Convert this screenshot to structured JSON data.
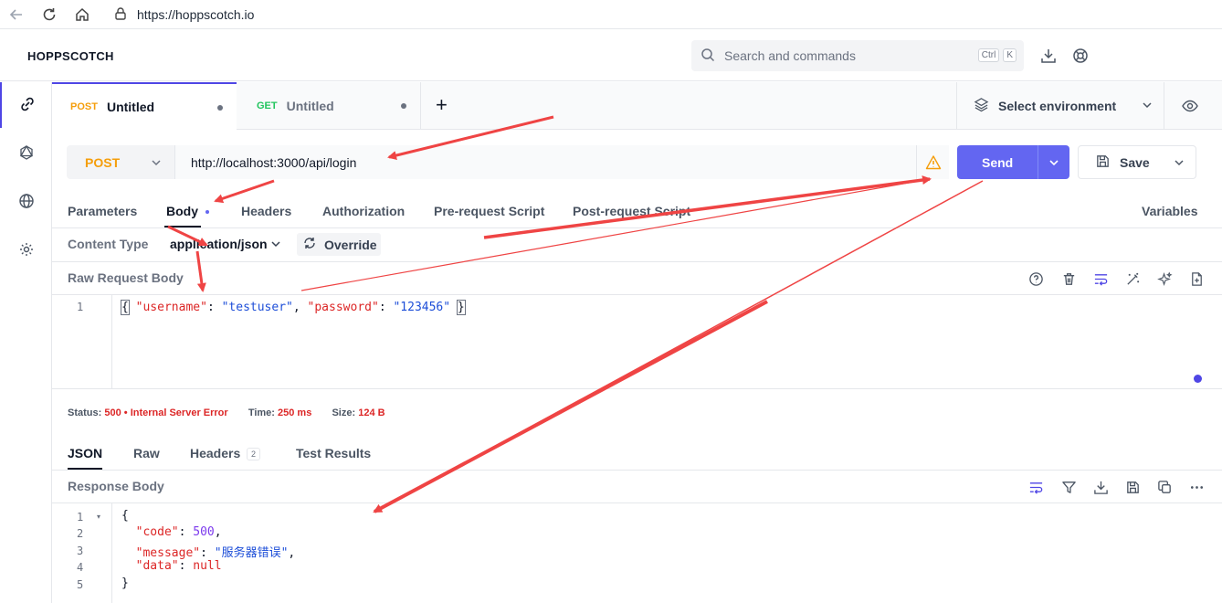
{
  "browser": {
    "url": "https://hoppscotch.io"
  },
  "app": {
    "brand": "HOPPSCOTCH",
    "search_placeholder": "Search and commands",
    "shortcut_keys": [
      "Ctrl",
      "K"
    ]
  },
  "tabs": [
    {
      "method": "POST",
      "title": "Untitled",
      "method_color": "#f59e0b",
      "active": true
    },
    {
      "method": "GET",
      "title": "Untitled",
      "method_color": "#22c55e",
      "active": false
    }
  ],
  "add_tab_label": "+",
  "environment": {
    "label": "Select environment"
  },
  "request": {
    "method": "POST",
    "url": "http://localhost:3000/api/login",
    "send_label": "Send",
    "save_label": "Save"
  },
  "request_tabs": [
    "Parameters",
    "Body",
    "Headers",
    "Authorization",
    "Pre-request Script",
    "Post-request Script"
  ],
  "variables_label": "Variables",
  "content_type": {
    "label": "Content Type",
    "value": "application/json",
    "override_label": "Override"
  },
  "raw_body": {
    "label": "Raw Request Body",
    "line_number": "1",
    "open": "{",
    "k1": "\"username\"",
    "colon1": ": ",
    "v1": "\"testuser\"",
    "comma": ", ",
    "k2": "\"password\"",
    "colon2": ": ",
    "v2": "\"123456\"",
    "close": "}"
  },
  "status_bar": {
    "status_label": "Status:",
    "status_code": "500",
    "bullet": "•",
    "status_text": "Internal Server Error",
    "time_label": "Time:",
    "time_value": "250 ms",
    "size_label": "Size:",
    "size_value": "124 B"
  },
  "response_tabs": [
    "JSON",
    "Raw",
    "Headers",
    "Test Results"
  ],
  "headers_count": "2",
  "response_body": {
    "label": "Response Body",
    "line_numbers": [
      "1",
      "2",
      "3",
      "4",
      "5"
    ],
    "open": "{",
    "code_key": "\"code\"",
    "code_val": "500",
    "message_key": "\"message\"",
    "message_val": "\"服务器错误\"",
    "data_key": "\"data\"",
    "data_val": "null",
    "close": "}"
  },
  "colors": {
    "accent": "#6366f1",
    "post": "#f59e0b",
    "get": "#22c55e",
    "error": "#dc2626",
    "annotation_arrow": "#ef4444"
  }
}
